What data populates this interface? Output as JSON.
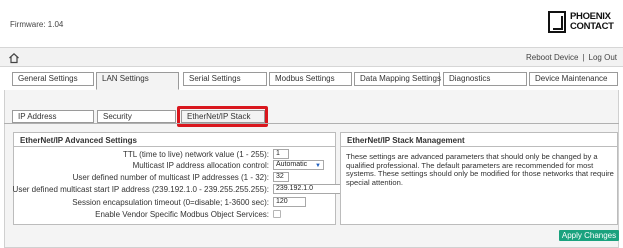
{
  "header": {
    "firmware": "Firmware: 1.04",
    "logo_line1": "PHOENIX",
    "logo_line2": "CONTACT"
  },
  "nav": {
    "reboot": "Reboot Device",
    "separator": "|",
    "logout": "Log Out"
  },
  "tabs": [
    {
      "label": "General Settings"
    },
    {
      "label": "LAN Settings",
      "active": true
    },
    {
      "label": "Serial Settings"
    },
    {
      "label": "Modbus Settings"
    },
    {
      "label": "Data Mapping Settings"
    },
    {
      "label": "Diagnostics"
    },
    {
      "label": "Device Maintenance"
    }
  ],
  "subtabs": [
    {
      "label": "IP Address"
    },
    {
      "label": "Security"
    },
    {
      "label": "EtherNet/IP Stack",
      "active": true
    }
  ],
  "advanced": {
    "title": "EtherNet/IP Advanced Settings",
    "rows": [
      {
        "label": "TTL (time to live) network value (1 - 255):",
        "value": "1"
      },
      {
        "label": "Multicast IP address allocation control:",
        "value": "Automatic"
      },
      {
        "label": "User defined number of multicast IP addresses (1 - 32):",
        "value": "32"
      },
      {
        "label": "User defined multicast start IP address (239.192.1.0 - 239.255.255.255):",
        "value": "239.192.1.0"
      },
      {
        "label": "Session encapsulation timeout (0=disable; 1-3600 sec):",
        "value": "120"
      },
      {
        "label": "Enable Vendor Specific Modbus Object Services:",
        "checked": false
      }
    ]
  },
  "management": {
    "title": "EtherNet/IP Stack Management",
    "text": "These settings are advanced parameters that should only be changed by a qualified professional. The default parameters are recommended for most systems. These settings should only be modified for those networks that require special attention."
  },
  "actions": {
    "apply": "Apply Changes"
  },
  "colors": {
    "highlight": "#d9171e",
    "apply_button": "#1aa27e"
  }
}
